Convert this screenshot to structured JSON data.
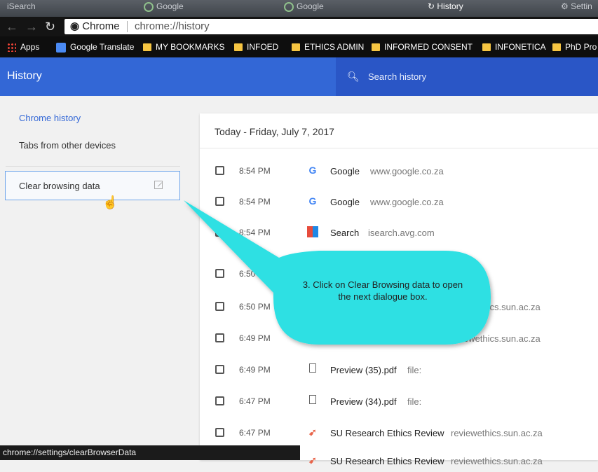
{
  "tabstrip": {
    "tabs": [
      {
        "label": "iSearch"
      },
      {
        "label": "Google"
      },
      {
        "label": "Google"
      },
      {
        "label": "History"
      },
      {
        "label": "Settin"
      }
    ]
  },
  "toolbar": {
    "security_label": "Chrome",
    "url": "chrome://history"
  },
  "bookmarks": {
    "items": [
      {
        "label": "Apps",
        "icon": "apps-grid-icon"
      },
      {
        "label": "Google Translate",
        "icon": "google-translate-icon"
      },
      {
        "label": "MY BOOKMARKS",
        "icon": "folder-icon"
      },
      {
        "label": "INFOED",
        "icon": "folder-icon"
      },
      {
        "label": "ETHICS ADMIN",
        "icon": "folder-icon"
      },
      {
        "label": "INFORMED CONSENT",
        "icon": "folder-icon"
      },
      {
        "label": "INFONETICA",
        "icon": "folder-icon"
      },
      {
        "label": "PhD Pro",
        "icon": "folder-icon"
      }
    ]
  },
  "header": {
    "title": "History",
    "search_placeholder": "Search history"
  },
  "sidebar": {
    "chrome_history": "Chrome history",
    "tabs_other_devices": "Tabs from other devices",
    "clear_browsing_data": "Clear browsing data"
  },
  "main": {
    "day_heading": "Today - Friday, July 7, 2017",
    "rows": [
      {
        "time": "8:54 PM",
        "icon": "google-icon",
        "title": "Google",
        "domain": "www.google.co.za"
      },
      {
        "time": "8:54 PM",
        "icon": "google-icon",
        "title": "Google",
        "domain": "www.google.co.za"
      },
      {
        "time": "8:54 PM",
        "icon": "avg-search-icon",
        "title": "Search",
        "domain": "isearch.avg.com"
      },
      {
        "time": "6:50 PM",
        "icon": "",
        "title": "",
        "domain": ""
      },
      {
        "time": "6:50 PM",
        "icon": "",
        "title": "",
        "domain": "reviewethics.sun.ac.za"
      },
      {
        "time": "6:49 PM",
        "icon": "",
        "title": "",
        "domain": "reviewethics.sun.ac.za"
      },
      {
        "time": "6:49 PM",
        "icon": "file-icon",
        "title": "Preview (35).pdf",
        "domain": "file:"
      },
      {
        "time": "6:47 PM",
        "icon": "file-icon",
        "title": "Preview (34).pdf",
        "domain": "file:"
      },
      {
        "time": "6:47 PM",
        "icon": "su-ethics-icon",
        "title": "SU Research Ethics Review",
        "domain": "reviewethics.sun.ac.za"
      },
      {
        "time": "",
        "icon": "su-ethics-icon",
        "title": "SU Research Ethics Review",
        "domain": "reviewethics.sun.ac.za"
      }
    ]
  },
  "callout": {
    "text": "3. Click on Clear Browsing data to open the next dialogue box.",
    "color": "#2ee0e3"
  },
  "status_bar": {
    "text": "chrome://settings/clearBrowserData"
  },
  "colors": {
    "app_bar": "#3367d6",
    "search_bar": "#2a56c6",
    "link_blue": "#3367d6",
    "bookmark_folder": "#f6c542"
  }
}
